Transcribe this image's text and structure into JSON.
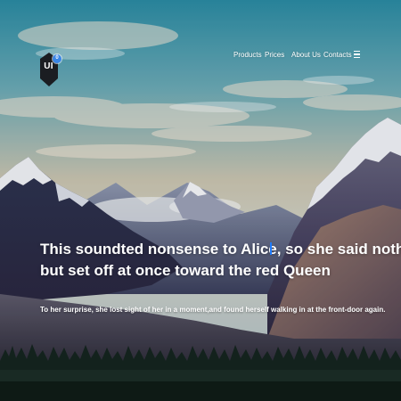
{
  "brand": {
    "logo_text": "UI",
    "badge_text": "0"
  },
  "nav": {
    "items": [
      {
        "label": "Products"
      },
      {
        "label": "Prices"
      },
      {
        "label": "About Us"
      },
      {
        "label": "Contacts"
      }
    ],
    "menu_icon": "hamburger-menu-icon"
  },
  "hero": {
    "headline_line1": "This soundted nonsense to Alice, so she said nothing,",
    "headline_line2": "but set off at once toward the red Queen",
    "subtext": "To her surprise, she lost sight of her in a moment,and found herself walking in at the front-door again.",
    "background": "mountain-landscape-photo"
  },
  "colors": {
    "accent": "#3a86e6",
    "cursor": "#1e7cff",
    "text": "#ffffff",
    "logo": "#1b1d22"
  }
}
